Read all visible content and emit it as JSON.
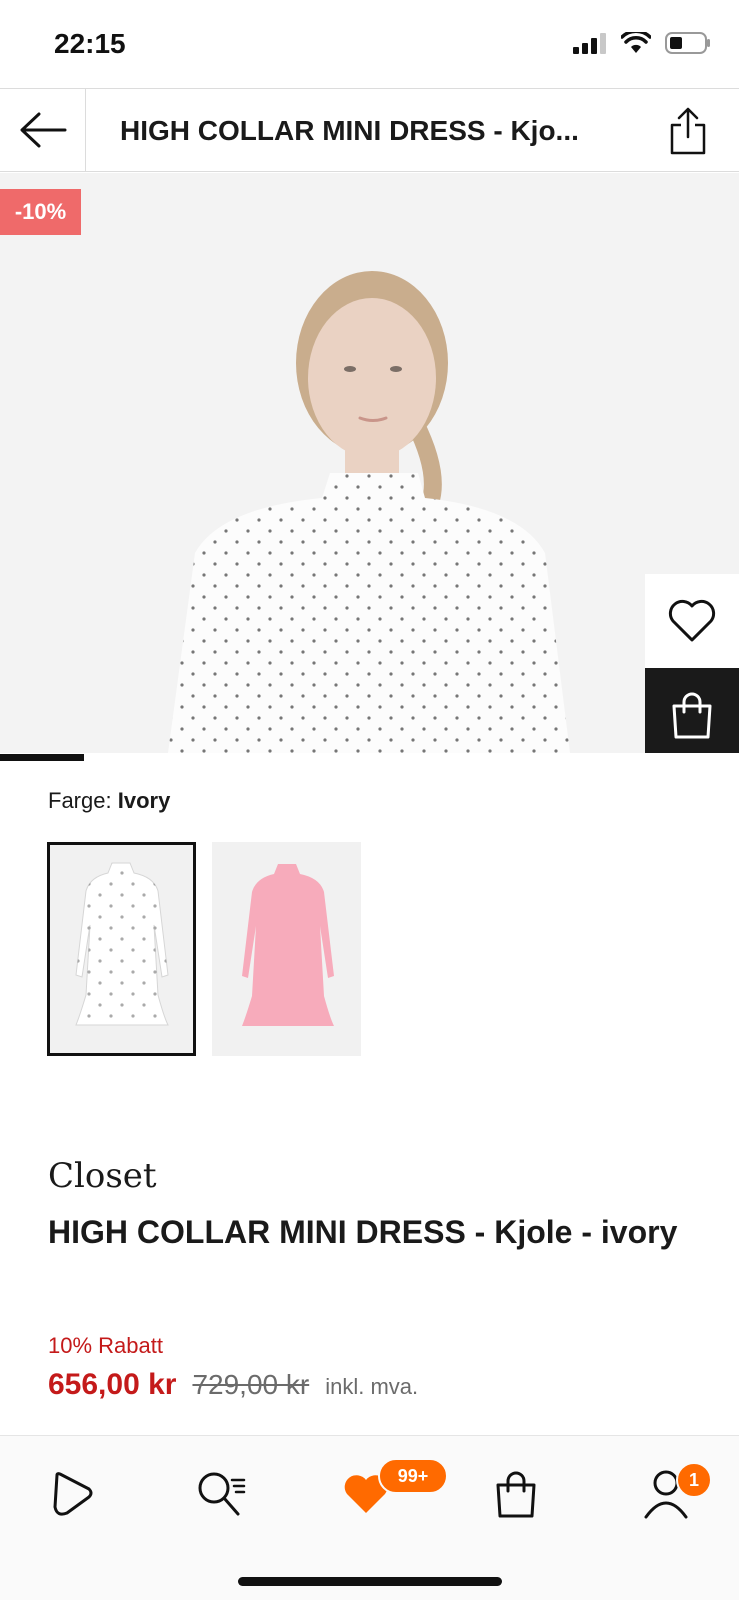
{
  "status_bar": {
    "time": "22:15",
    "signal_icon": "cellular-signal-icon",
    "wifi_icon": "wifi-icon",
    "battery_icon": "battery-icon"
  },
  "header": {
    "back_icon": "arrow-left-icon",
    "title": "HIGH COLLAR MINI DRESS - Kjo...",
    "share_icon": "share-icon"
  },
  "hero": {
    "discount": "-10%",
    "wishlist_icon": "heart-icon",
    "add_to_bag_icon": "shopping-bag-icon",
    "gallery_progress": 0.14
  },
  "color": {
    "label": "Farge:",
    "selected": "Ivory",
    "swatches": [
      {
        "name": "ivory",
        "color": "#ffffff",
        "selected": true
      },
      {
        "name": "pink",
        "color": "#f6a9b9",
        "selected": false
      }
    ]
  },
  "product": {
    "brand": "Closet",
    "name": "HIGH COLLAR MINI DRESS - Kjole - ivory",
    "discount_text": "10% Rabatt",
    "price": "656,00 kr",
    "original_price": "729,00 kr",
    "vat_text": "inkl. mva."
  },
  "bottom_nav": {
    "home_icon": "home-play-icon",
    "search_icon": "search-icon",
    "wishlist_icon": "heart-icon",
    "wishlist_badge": "99+",
    "cart_icon": "shopping-bag-icon",
    "profile_icon": "profile-icon",
    "profile_badge": "1"
  },
  "colors": {
    "accent_orange": "#ff6a00",
    "sale_red": "#c41a1a",
    "badge_red": "#ef6a6a"
  }
}
